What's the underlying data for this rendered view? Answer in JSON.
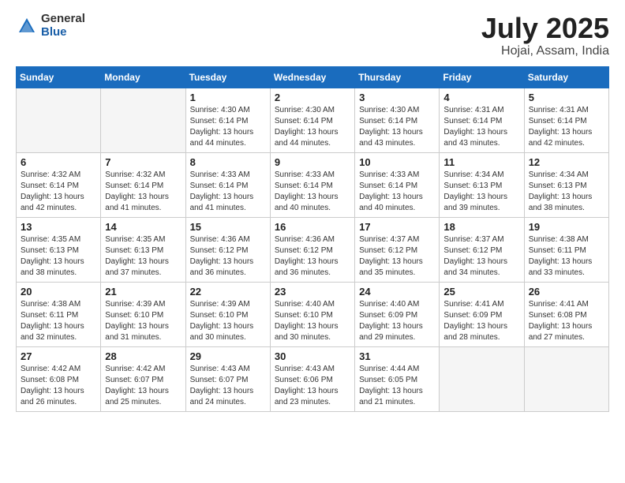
{
  "header": {
    "logo_general": "General",
    "logo_blue": "Blue",
    "month": "July 2025",
    "location": "Hojai, Assam, India"
  },
  "days_of_week": [
    "Sunday",
    "Monday",
    "Tuesday",
    "Wednesday",
    "Thursday",
    "Friday",
    "Saturday"
  ],
  "weeks": [
    [
      {
        "day": "",
        "info": ""
      },
      {
        "day": "",
        "info": ""
      },
      {
        "day": "1",
        "info": "Sunrise: 4:30 AM\nSunset: 6:14 PM\nDaylight: 13 hours and 44 minutes."
      },
      {
        "day": "2",
        "info": "Sunrise: 4:30 AM\nSunset: 6:14 PM\nDaylight: 13 hours and 44 minutes."
      },
      {
        "day": "3",
        "info": "Sunrise: 4:30 AM\nSunset: 6:14 PM\nDaylight: 13 hours and 43 minutes."
      },
      {
        "day": "4",
        "info": "Sunrise: 4:31 AM\nSunset: 6:14 PM\nDaylight: 13 hours and 43 minutes."
      },
      {
        "day": "5",
        "info": "Sunrise: 4:31 AM\nSunset: 6:14 PM\nDaylight: 13 hours and 42 minutes."
      }
    ],
    [
      {
        "day": "6",
        "info": "Sunrise: 4:32 AM\nSunset: 6:14 PM\nDaylight: 13 hours and 42 minutes."
      },
      {
        "day": "7",
        "info": "Sunrise: 4:32 AM\nSunset: 6:14 PM\nDaylight: 13 hours and 41 minutes."
      },
      {
        "day": "8",
        "info": "Sunrise: 4:33 AM\nSunset: 6:14 PM\nDaylight: 13 hours and 41 minutes."
      },
      {
        "day": "9",
        "info": "Sunrise: 4:33 AM\nSunset: 6:14 PM\nDaylight: 13 hours and 40 minutes."
      },
      {
        "day": "10",
        "info": "Sunrise: 4:33 AM\nSunset: 6:14 PM\nDaylight: 13 hours and 40 minutes."
      },
      {
        "day": "11",
        "info": "Sunrise: 4:34 AM\nSunset: 6:13 PM\nDaylight: 13 hours and 39 minutes."
      },
      {
        "day": "12",
        "info": "Sunrise: 4:34 AM\nSunset: 6:13 PM\nDaylight: 13 hours and 38 minutes."
      }
    ],
    [
      {
        "day": "13",
        "info": "Sunrise: 4:35 AM\nSunset: 6:13 PM\nDaylight: 13 hours and 38 minutes."
      },
      {
        "day": "14",
        "info": "Sunrise: 4:35 AM\nSunset: 6:13 PM\nDaylight: 13 hours and 37 minutes."
      },
      {
        "day": "15",
        "info": "Sunrise: 4:36 AM\nSunset: 6:12 PM\nDaylight: 13 hours and 36 minutes."
      },
      {
        "day": "16",
        "info": "Sunrise: 4:36 AM\nSunset: 6:12 PM\nDaylight: 13 hours and 36 minutes."
      },
      {
        "day": "17",
        "info": "Sunrise: 4:37 AM\nSunset: 6:12 PM\nDaylight: 13 hours and 35 minutes."
      },
      {
        "day": "18",
        "info": "Sunrise: 4:37 AM\nSunset: 6:12 PM\nDaylight: 13 hours and 34 minutes."
      },
      {
        "day": "19",
        "info": "Sunrise: 4:38 AM\nSunset: 6:11 PM\nDaylight: 13 hours and 33 minutes."
      }
    ],
    [
      {
        "day": "20",
        "info": "Sunrise: 4:38 AM\nSunset: 6:11 PM\nDaylight: 13 hours and 32 minutes."
      },
      {
        "day": "21",
        "info": "Sunrise: 4:39 AM\nSunset: 6:10 PM\nDaylight: 13 hours and 31 minutes."
      },
      {
        "day": "22",
        "info": "Sunrise: 4:39 AM\nSunset: 6:10 PM\nDaylight: 13 hours and 30 minutes."
      },
      {
        "day": "23",
        "info": "Sunrise: 4:40 AM\nSunset: 6:10 PM\nDaylight: 13 hours and 30 minutes."
      },
      {
        "day": "24",
        "info": "Sunrise: 4:40 AM\nSunset: 6:09 PM\nDaylight: 13 hours and 29 minutes."
      },
      {
        "day": "25",
        "info": "Sunrise: 4:41 AM\nSunset: 6:09 PM\nDaylight: 13 hours and 28 minutes."
      },
      {
        "day": "26",
        "info": "Sunrise: 4:41 AM\nSunset: 6:08 PM\nDaylight: 13 hours and 27 minutes."
      }
    ],
    [
      {
        "day": "27",
        "info": "Sunrise: 4:42 AM\nSunset: 6:08 PM\nDaylight: 13 hours and 26 minutes."
      },
      {
        "day": "28",
        "info": "Sunrise: 4:42 AM\nSunset: 6:07 PM\nDaylight: 13 hours and 25 minutes."
      },
      {
        "day": "29",
        "info": "Sunrise: 4:43 AM\nSunset: 6:07 PM\nDaylight: 13 hours and 24 minutes."
      },
      {
        "day": "30",
        "info": "Sunrise: 4:43 AM\nSunset: 6:06 PM\nDaylight: 13 hours and 23 minutes."
      },
      {
        "day": "31",
        "info": "Sunrise: 4:44 AM\nSunset: 6:05 PM\nDaylight: 13 hours and 21 minutes."
      },
      {
        "day": "",
        "info": ""
      },
      {
        "day": "",
        "info": ""
      }
    ]
  ]
}
